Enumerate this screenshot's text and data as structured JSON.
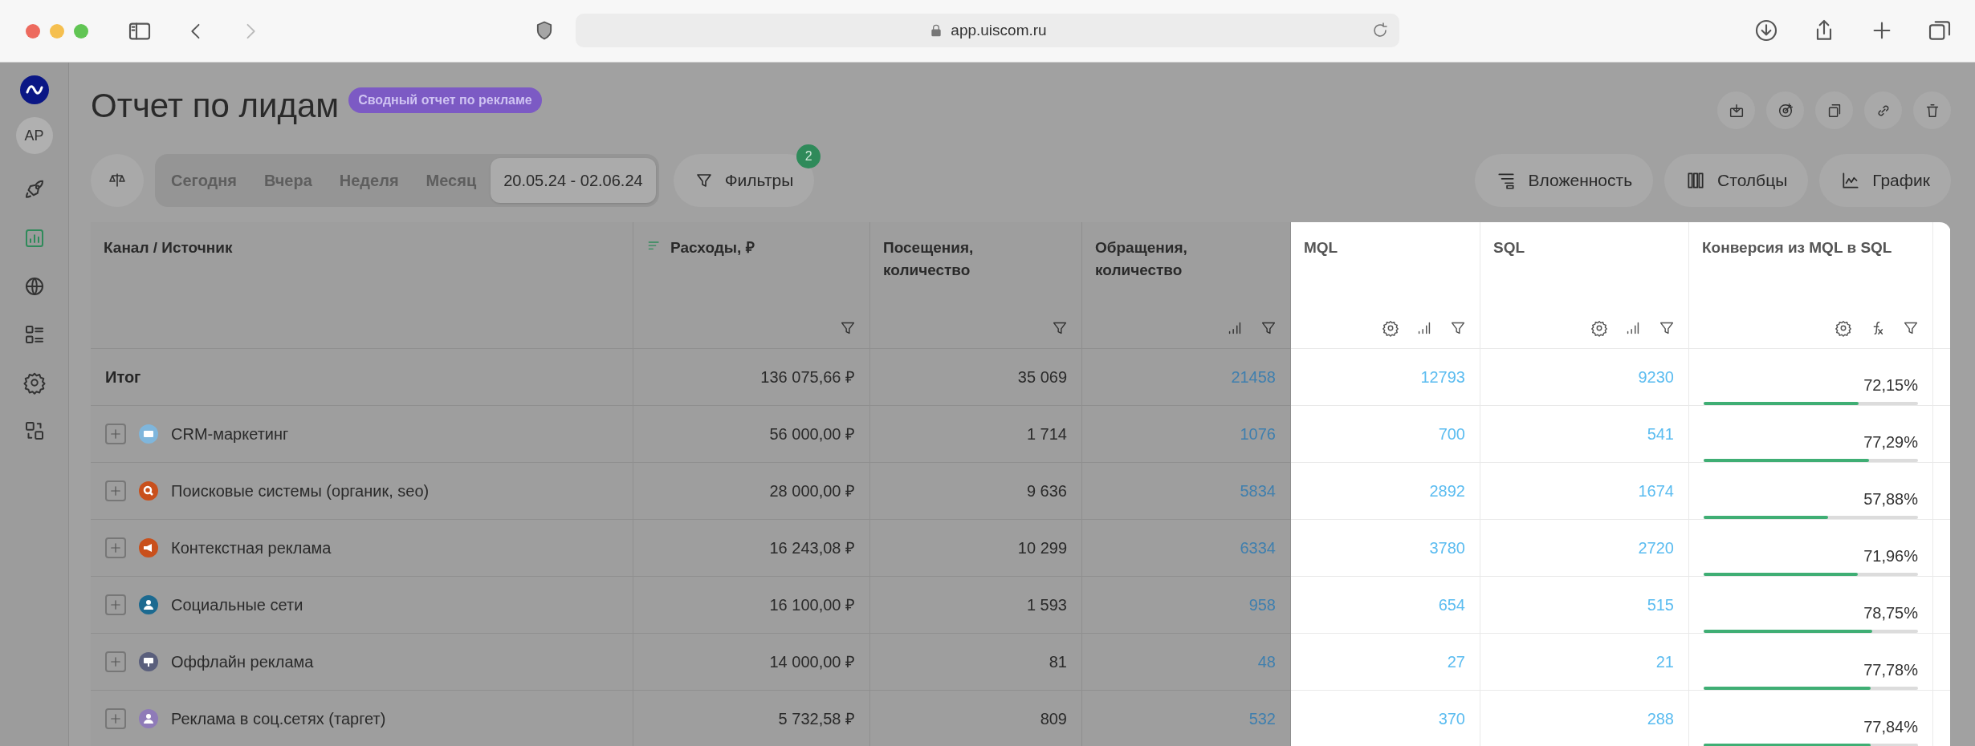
{
  "browser": {
    "url": "app.uiscom.ru"
  },
  "sidebar": {
    "avatar": "AP",
    "items": [
      {
        "selected": false
      },
      {
        "selected": true
      },
      {
        "selected": false
      },
      {
        "selected": false
      },
      {
        "selected": false
      },
      {
        "selected": false
      }
    ]
  },
  "header": {
    "title": "Отчет по лидам",
    "badge": "Сводный отчет по рекламе"
  },
  "periods": [
    {
      "label": "Сегодня",
      "selected": false
    },
    {
      "label": "Вчера",
      "selected": false
    },
    {
      "label": "Неделя",
      "selected": false
    },
    {
      "label": "Месяц",
      "selected": false
    },
    {
      "label": "20.05.24 - 02.06.24",
      "selected": true
    }
  ],
  "filters": {
    "label": "Фильтры",
    "count": "2"
  },
  "view_buttons": [
    {
      "label": "Вложенность"
    },
    {
      "label": "Столбцы"
    },
    {
      "label": "График"
    }
  ],
  "table": {
    "columns": [
      {
        "label": "Канал / Источник",
        "kind": "name",
        "highlighted": false,
        "sorted": false
      },
      {
        "label": "Расходы, ₽",
        "kind": "plain",
        "highlighted": false,
        "sorted": true
      },
      {
        "label": "Посещения, количество",
        "kind": "plain",
        "highlighted": false,
        "sorted": false
      },
      {
        "label": "Обращения, количество",
        "kind": "link",
        "highlighted": false,
        "sorted": false
      },
      {
        "label": "MQL",
        "kind": "link",
        "highlighted": true,
        "sorted": false
      },
      {
        "label": "SQL",
        "kind": "link",
        "highlighted": true,
        "sorted": false
      },
      {
        "label": "Конверсия из MQL в SQL",
        "kind": "bar",
        "highlighted": true,
        "sorted": false
      }
    ],
    "rows": [
      {
        "kind": "total",
        "name": "Итог",
        "cells": [
          "136 075,66 ₽",
          "35 069",
          "21458",
          "12793",
          "9230",
          {
            "reading": "72,15%",
            "level": 0.7215
          }
        ]
      },
      {
        "kind": "channel",
        "name": "CRM-маркетинг",
        "color": "#7fb6dc",
        "cells": [
          "56 000,00 ₽",
          "1 714",
          "1076",
          "700",
          "541",
          {
            "reading": "77,29%",
            "level": 0.7729
          }
        ]
      },
      {
        "kind": "channel",
        "name": "Поисковые системы (органик, seo)",
        "color": "#c9501c",
        "cells": [
          "28 000,00 ₽",
          "9 636",
          "5834",
          "2892",
          "1674",
          {
            "reading": "57,88%",
            "level": 0.5788
          }
        ]
      },
      {
        "kind": "channel",
        "name": "Контекстная реклама",
        "color": "#c9501c",
        "cells": [
          "16 243,08 ₽",
          "10 299",
          "6334",
          "3780",
          "2720",
          {
            "reading": "71,96%",
            "level": 0.7196
          }
        ]
      },
      {
        "kind": "channel",
        "name": "Социальные сети",
        "color": "#1c6a90",
        "cells": [
          "16 100,00 ₽",
          "1 593",
          "958",
          "654",
          "515",
          {
            "reading": "78,75%",
            "level": 0.7875
          }
        ]
      },
      {
        "kind": "channel",
        "name": "Оффлайн реклама",
        "color": "#5a5f7c",
        "cells": [
          "14 000,00 ₽",
          "81",
          "48",
          "27",
          "21",
          {
            "reading": "77,78%",
            "level": 0.7778
          }
        ]
      },
      {
        "kind": "channel",
        "name": "Реклама в соц.сетях (таргет)",
        "color": "#8f7bb8",
        "cells": [
          "5 732,58 ₽",
          "809",
          "532",
          "370",
          "288",
          {
            "reading": "77,84%",
            "level": 0.7784
          }
        ]
      }
    ]
  }
}
